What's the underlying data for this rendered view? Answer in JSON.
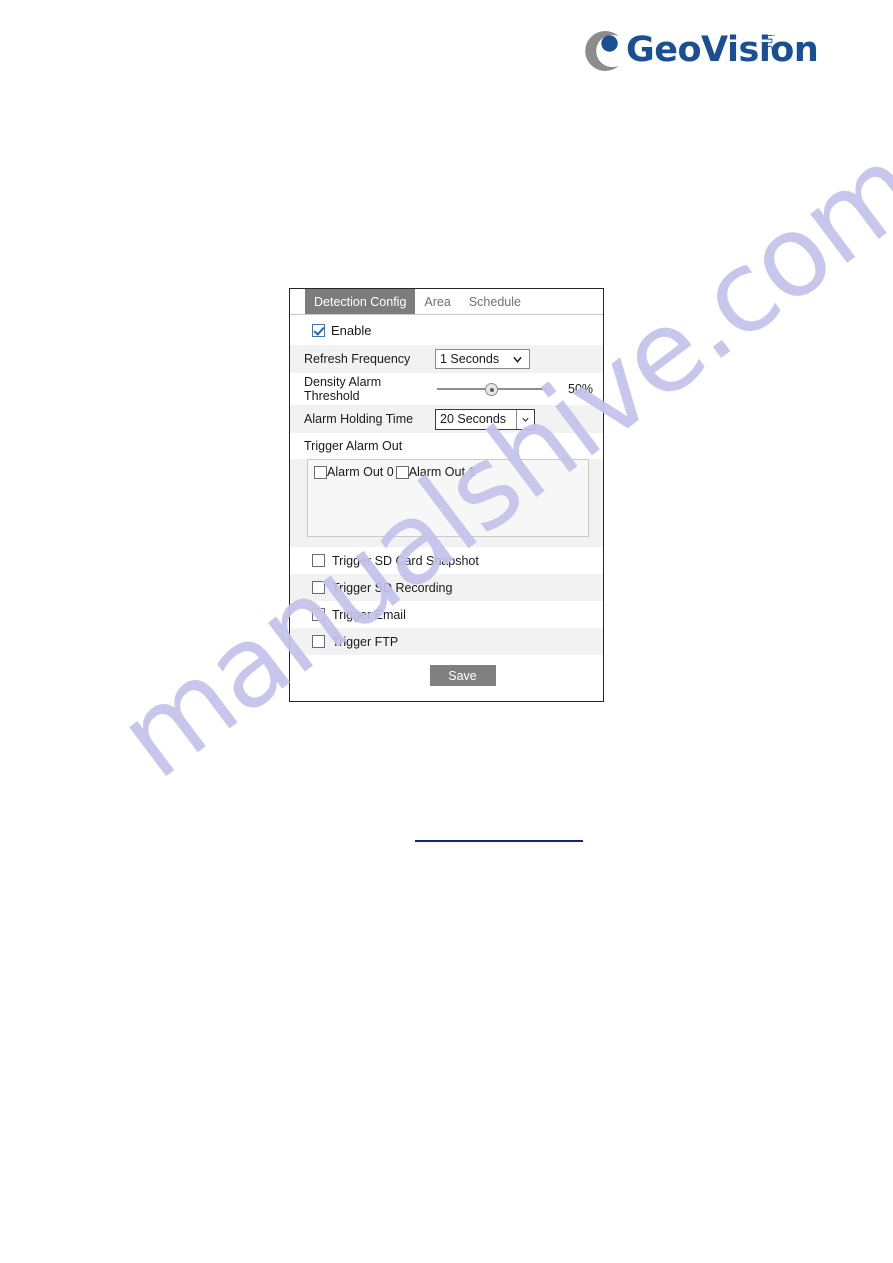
{
  "logo": {
    "wordmark": "GeoVision",
    "suffix": "inc",
    "mark_icon": "geovision-c-mark-icon",
    "brand_blue": "#1b4f93",
    "brand_gray": "#808080"
  },
  "watermark": {
    "text": "manualshive.com",
    "color": "#c3c3ec"
  },
  "panel": {
    "tabs": [
      {
        "label": "Detection Config",
        "active": true
      },
      {
        "label": "Area",
        "active": false
      },
      {
        "label": "Schedule",
        "active": false
      }
    ],
    "enable": {
      "label": "Enable",
      "checked": true
    },
    "refresh_frequency": {
      "label": "Refresh Frequency",
      "value": "1 Seconds",
      "icon": "chevron-down-icon"
    },
    "density_alarm_threshold": {
      "label": "Density Alarm Threshold",
      "value": 50,
      "value_text": "50%",
      "min": 0,
      "max": 100
    },
    "alarm_holding_time": {
      "label": "Alarm Holding Time",
      "value": "20 Seconds",
      "icon": "chevron-down-icon"
    },
    "trigger_alarm_out": {
      "title": "Trigger Alarm Out",
      "options": [
        {
          "label": "Alarm Out 0",
          "checked": false
        },
        {
          "label": "Alarm Out 1",
          "checked": false
        }
      ]
    },
    "triggers": [
      {
        "label": "Trigger SD Card Snapshot",
        "checked": false
      },
      {
        "label": "Trigger SD Recording",
        "checked": false
      },
      {
        "label": "Trigger Email",
        "checked": false
      },
      {
        "label": "Trigger FTP",
        "checked": false
      }
    ],
    "save_label": "Save"
  }
}
